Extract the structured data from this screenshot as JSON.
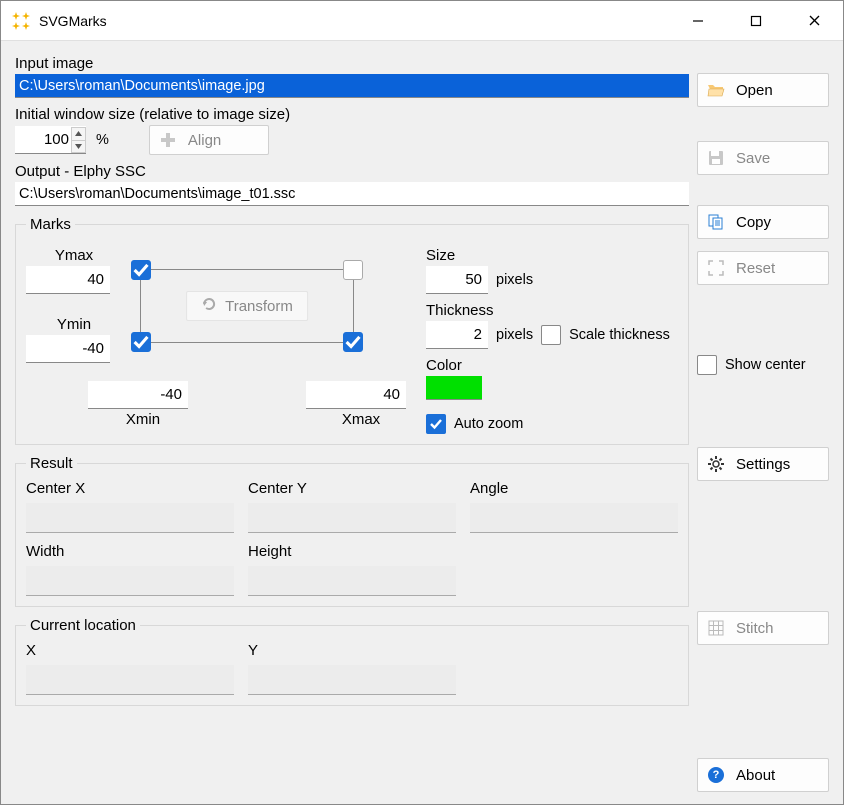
{
  "window": {
    "title": "SVGMarks"
  },
  "input_image": {
    "label": "Input image",
    "path": "C:\\Users\\roman\\Documents\\image.jpg"
  },
  "initial_size": {
    "label": "Initial window size (relative to image size)",
    "value": "100",
    "unit": "%",
    "align_label": "Align"
  },
  "output": {
    "label": "Output - Elphy SSC",
    "path": "C:\\Users\\roman\\Documents\\image_t01.ssc"
  },
  "marks": {
    "legend": "Marks",
    "ymax_label": "Ymax",
    "ymax": "40",
    "ymin_label": "Ymin",
    "ymin": "-40",
    "xmin_label": "Xmin",
    "xmin": "-40",
    "xmax_label": "Xmax",
    "xmax": "40",
    "transform_label": "Transform",
    "size_label": "Size",
    "size": "50",
    "size_unit": "pixels",
    "thickness_label": "Thickness",
    "thickness": "2",
    "thickness_unit": "pixels",
    "scale_thickness_label": "Scale thickness",
    "color_label": "Color",
    "color": "#00e000",
    "auto_zoom_label": "Auto zoom",
    "handles": {
      "tl": true,
      "tr": false,
      "bl": true,
      "br": true
    }
  },
  "result": {
    "legend": "Result",
    "center_x_label": "Center X",
    "center_y_label": "Center Y",
    "angle_label": "Angle",
    "width_label": "Width",
    "height_label": "Height",
    "center_x": "",
    "center_y": "",
    "angle": "",
    "width": "",
    "height": ""
  },
  "location": {
    "legend": "Current location",
    "x_label": "X",
    "y_label": "Y",
    "x": "",
    "y": ""
  },
  "buttons": {
    "open": "Open",
    "save": "Save",
    "copy": "Copy",
    "reset": "Reset",
    "show_center": "Show center",
    "settings": "Settings",
    "stitch": "Stitch",
    "about": "About"
  }
}
